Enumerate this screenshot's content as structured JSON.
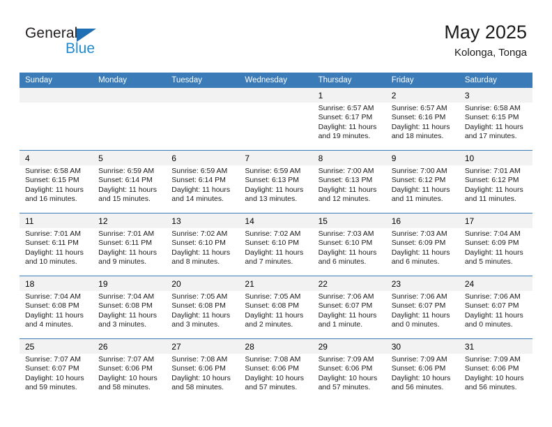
{
  "logo": {
    "primary_text": "General",
    "secondary_text": "Blue",
    "triangle_icon": "blue-triangle-icon",
    "primary_color": "#231f20",
    "secondary_color": "#1f8ad0",
    "triangle_color": "#1f6fb4"
  },
  "header": {
    "title": "May 2025",
    "subtitle": "Kolonga, Tonga"
  },
  "theme": {
    "header_row_bg": "#3b7cb8",
    "header_row_text": "#ffffff",
    "daynum_bg": "#f2f2f2",
    "cell_bg": "#ffffff",
    "separator": "#3b7cb8"
  },
  "weekday_headers": [
    "Sunday",
    "Monday",
    "Tuesday",
    "Wednesday",
    "Thursday",
    "Friday",
    "Saturday"
  ],
  "weeks": [
    {
      "days": [
        {
          "number": "",
          "sunrise": "",
          "sunset": "",
          "daylight": ""
        },
        {
          "number": "",
          "sunrise": "",
          "sunset": "",
          "daylight": ""
        },
        {
          "number": "",
          "sunrise": "",
          "sunset": "",
          "daylight": ""
        },
        {
          "number": "",
          "sunrise": "",
          "sunset": "",
          "daylight": ""
        },
        {
          "number": "1",
          "sunrise": "Sunrise: 6:57 AM",
          "sunset": "Sunset: 6:17 PM",
          "daylight": "Daylight: 11 hours and 19 minutes."
        },
        {
          "number": "2",
          "sunrise": "Sunrise: 6:57 AM",
          "sunset": "Sunset: 6:16 PM",
          "daylight": "Daylight: 11 hours and 18 minutes."
        },
        {
          "number": "3",
          "sunrise": "Sunrise: 6:58 AM",
          "sunset": "Sunset: 6:15 PM",
          "daylight": "Daylight: 11 hours and 17 minutes."
        }
      ]
    },
    {
      "days": [
        {
          "number": "4",
          "sunrise": "Sunrise: 6:58 AM",
          "sunset": "Sunset: 6:15 PM",
          "daylight": "Daylight: 11 hours and 16 minutes."
        },
        {
          "number": "5",
          "sunrise": "Sunrise: 6:59 AM",
          "sunset": "Sunset: 6:14 PM",
          "daylight": "Daylight: 11 hours and 15 minutes."
        },
        {
          "number": "6",
          "sunrise": "Sunrise: 6:59 AM",
          "sunset": "Sunset: 6:14 PM",
          "daylight": "Daylight: 11 hours and 14 minutes."
        },
        {
          "number": "7",
          "sunrise": "Sunrise: 6:59 AM",
          "sunset": "Sunset: 6:13 PM",
          "daylight": "Daylight: 11 hours and 13 minutes."
        },
        {
          "number": "8",
          "sunrise": "Sunrise: 7:00 AM",
          "sunset": "Sunset: 6:13 PM",
          "daylight": "Daylight: 11 hours and 12 minutes."
        },
        {
          "number": "9",
          "sunrise": "Sunrise: 7:00 AM",
          "sunset": "Sunset: 6:12 PM",
          "daylight": "Daylight: 11 hours and 11 minutes."
        },
        {
          "number": "10",
          "sunrise": "Sunrise: 7:01 AM",
          "sunset": "Sunset: 6:12 PM",
          "daylight": "Daylight: 11 hours and 11 minutes."
        }
      ]
    },
    {
      "days": [
        {
          "number": "11",
          "sunrise": "Sunrise: 7:01 AM",
          "sunset": "Sunset: 6:11 PM",
          "daylight": "Daylight: 11 hours and 10 minutes."
        },
        {
          "number": "12",
          "sunrise": "Sunrise: 7:01 AM",
          "sunset": "Sunset: 6:11 PM",
          "daylight": "Daylight: 11 hours and 9 minutes."
        },
        {
          "number": "13",
          "sunrise": "Sunrise: 7:02 AM",
          "sunset": "Sunset: 6:10 PM",
          "daylight": "Daylight: 11 hours and 8 minutes."
        },
        {
          "number": "14",
          "sunrise": "Sunrise: 7:02 AM",
          "sunset": "Sunset: 6:10 PM",
          "daylight": "Daylight: 11 hours and 7 minutes."
        },
        {
          "number": "15",
          "sunrise": "Sunrise: 7:03 AM",
          "sunset": "Sunset: 6:10 PM",
          "daylight": "Daylight: 11 hours and 6 minutes."
        },
        {
          "number": "16",
          "sunrise": "Sunrise: 7:03 AM",
          "sunset": "Sunset: 6:09 PM",
          "daylight": "Daylight: 11 hours and 6 minutes."
        },
        {
          "number": "17",
          "sunrise": "Sunrise: 7:04 AM",
          "sunset": "Sunset: 6:09 PM",
          "daylight": "Daylight: 11 hours and 5 minutes."
        }
      ]
    },
    {
      "days": [
        {
          "number": "18",
          "sunrise": "Sunrise: 7:04 AM",
          "sunset": "Sunset: 6:08 PM",
          "daylight": "Daylight: 11 hours and 4 minutes."
        },
        {
          "number": "19",
          "sunrise": "Sunrise: 7:04 AM",
          "sunset": "Sunset: 6:08 PM",
          "daylight": "Daylight: 11 hours and 3 minutes."
        },
        {
          "number": "20",
          "sunrise": "Sunrise: 7:05 AM",
          "sunset": "Sunset: 6:08 PM",
          "daylight": "Daylight: 11 hours and 3 minutes."
        },
        {
          "number": "21",
          "sunrise": "Sunrise: 7:05 AM",
          "sunset": "Sunset: 6:08 PM",
          "daylight": "Daylight: 11 hours and 2 minutes."
        },
        {
          "number": "22",
          "sunrise": "Sunrise: 7:06 AM",
          "sunset": "Sunset: 6:07 PM",
          "daylight": "Daylight: 11 hours and 1 minute."
        },
        {
          "number": "23",
          "sunrise": "Sunrise: 7:06 AM",
          "sunset": "Sunset: 6:07 PM",
          "daylight": "Daylight: 11 hours and 0 minutes."
        },
        {
          "number": "24",
          "sunrise": "Sunrise: 7:06 AM",
          "sunset": "Sunset: 6:07 PM",
          "daylight": "Daylight: 11 hours and 0 minutes."
        }
      ]
    },
    {
      "days": [
        {
          "number": "25",
          "sunrise": "Sunrise: 7:07 AM",
          "sunset": "Sunset: 6:07 PM",
          "daylight": "Daylight: 10 hours and 59 minutes."
        },
        {
          "number": "26",
          "sunrise": "Sunrise: 7:07 AM",
          "sunset": "Sunset: 6:06 PM",
          "daylight": "Daylight: 10 hours and 58 minutes."
        },
        {
          "number": "27",
          "sunrise": "Sunrise: 7:08 AM",
          "sunset": "Sunset: 6:06 PM",
          "daylight": "Daylight: 10 hours and 58 minutes."
        },
        {
          "number": "28",
          "sunrise": "Sunrise: 7:08 AM",
          "sunset": "Sunset: 6:06 PM",
          "daylight": "Daylight: 10 hours and 57 minutes."
        },
        {
          "number": "29",
          "sunrise": "Sunrise: 7:09 AM",
          "sunset": "Sunset: 6:06 PM",
          "daylight": "Daylight: 10 hours and 57 minutes."
        },
        {
          "number": "30",
          "sunrise": "Sunrise: 7:09 AM",
          "sunset": "Sunset: 6:06 PM",
          "daylight": "Daylight: 10 hours and 56 minutes."
        },
        {
          "number": "31",
          "sunrise": "Sunrise: 7:09 AM",
          "sunset": "Sunset: 6:06 PM",
          "daylight": "Daylight: 10 hours and 56 minutes."
        }
      ]
    }
  ]
}
